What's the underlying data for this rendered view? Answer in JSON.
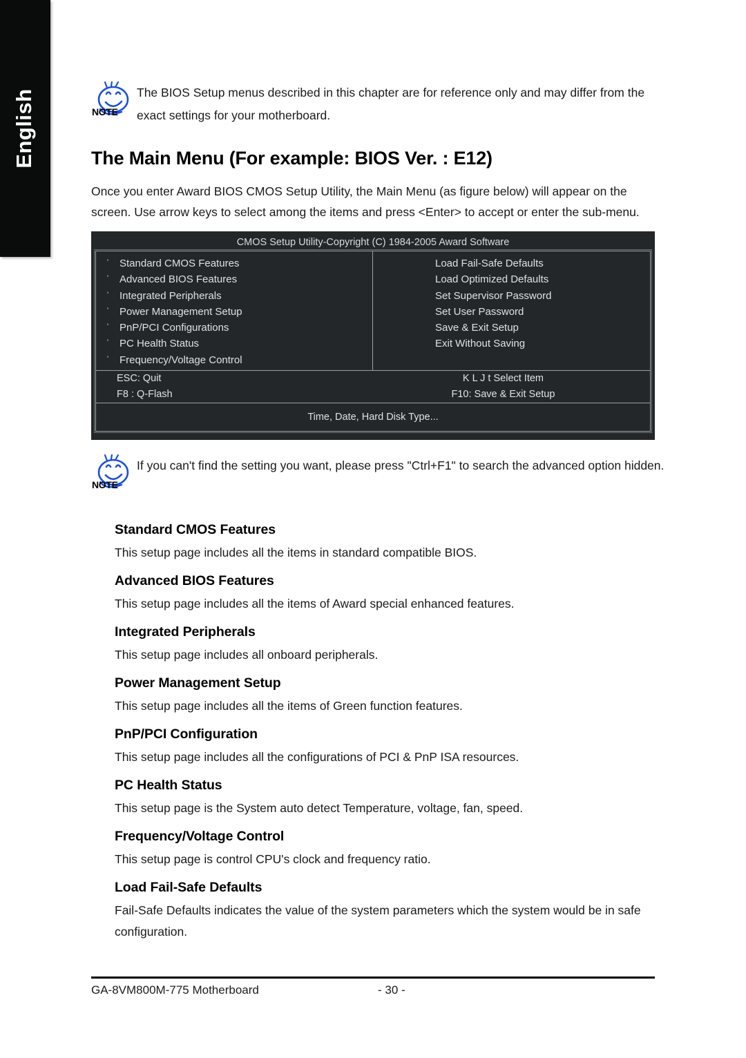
{
  "language_tab": {
    "label": "English"
  },
  "notes": {
    "top": {
      "icon": "note-smiley-icon",
      "badge": "NOTE",
      "text": "The BIOS Setup menus described in this chapter are for reference only and may differ from the exact settings for your motherboard."
    },
    "bottom": {
      "icon": "note-smiley-icon",
      "badge": "NOTE",
      "text": "If you can't find the setting you want, please press \"Ctrl+F1\" to search the advanced option hidden."
    }
  },
  "heading": "The Main Menu (For example: BIOS Ver. : E12)",
  "intro": "Once you enter Award BIOS CMOS Setup Utility, the Main Menu (as figure below) will appear on the screen. Use arrow keys to select among the items and press <Enter> to accept or enter the sub-menu.",
  "bios": {
    "title": "CMOS Setup Utility-Copyright (C) 1984-2005 Award Software",
    "bullet": "'",
    "left_items": [
      "Standard CMOS Features",
      "Advanced BIOS Features",
      "Integrated Peripherals",
      "Power Management Setup",
      "PnP/PCI Configurations",
      "PC Health Status",
      "Frequency/Voltage Control"
    ],
    "right_items": [
      "Load Fail-Safe Defaults",
      "Load Optimized Defaults",
      "Set Supervisor Password",
      "Set User Password",
      "Save & Exit Setup",
      "Exit Without Saving"
    ],
    "keys": {
      "row1_left": "ESC: Quit",
      "row1_right": "K L J t Select Item",
      "row2_left": "F8 : Q-Flash",
      "row2_right": "F10: Save & Exit Setup"
    },
    "status": "Time, Date, Hard Disk Type...",
    "colors": {
      "background": "#232729",
      "text": "#dfe3e3",
      "border": "#9aa3a3"
    }
  },
  "sections": [
    {
      "heading": "Standard CMOS Features",
      "body": "This setup page includes all the items in standard compatible BIOS."
    },
    {
      "heading": "Advanced BIOS Features",
      "body": "This setup page includes all the items of Award special enhanced features."
    },
    {
      "heading": "Integrated Peripherals",
      "body": "This setup page includes all onboard peripherals."
    },
    {
      "heading": "Power Management Setup",
      "body": "This setup page includes all the items of Green function features."
    },
    {
      "heading": "PnP/PCI Configuration",
      "body": "This setup page includes all the configurations of PCI & PnP ISA resources."
    },
    {
      "heading": "PC Health Status",
      "body": "This setup page is the System auto detect Temperature, voltage, fan, speed."
    },
    {
      "heading": "Frequency/Voltage Control",
      "body": "This setup page is control CPU's clock and frequency ratio."
    },
    {
      "heading": "Load Fail-Safe Defaults",
      "body": "Fail-Safe Defaults indicates the value of the system parameters which the system would be in safe configuration."
    }
  ],
  "footer": {
    "left": "GA-8VM800M-775 Motherboard",
    "page": "- 30 -"
  }
}
